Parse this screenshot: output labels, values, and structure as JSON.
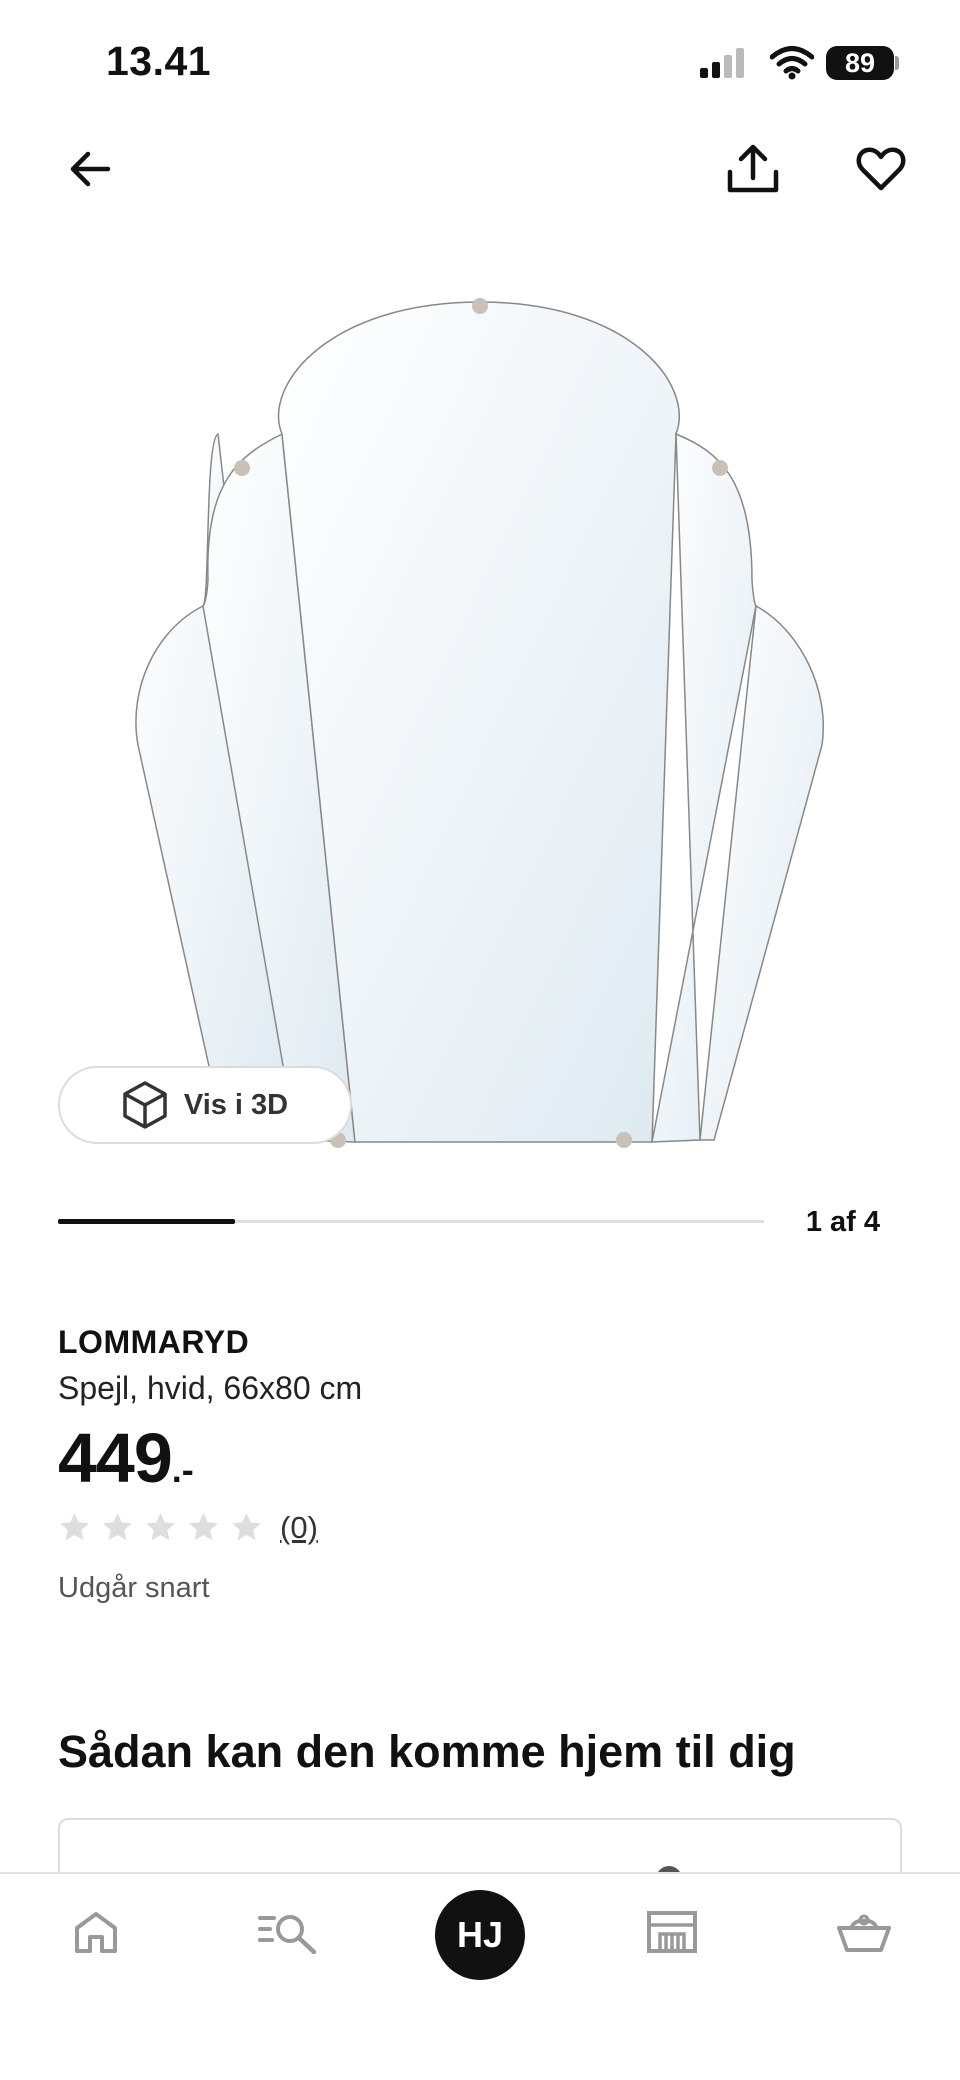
{
  "status_bar": {
    "time": "13.41",
    "battery": "89"
  },
  "header": {
    "back_icon": "arrow-left-icon",
    "share_icon": "share-icon",
    "favorite_icon": "heart-icon"
  },
  "gallery": {
    "view_3d_label": "Vis i 3D",
    "counter": "1 af 4",
    "progress_fraction": 0.25
  },
  "product": {
    "name": "LOMMARYD",
    "description": "Spejl, hvid, 66x80 cm",
    "price": "449",
    "price_suffix": ".-",
    "rating_stars": 0,
    "rating_count": "(0)",
    "availability": "Udgår snart"
  },
  "delivery": {
    "heading": "Sådan kan den komme hjem til dig"
  },
  "tabbar": {
    "profile_initials": "HJ",
    "tabs": [
      "home-icon",
      "search-icon",
      "profile-avatar",
      "store-icon",
      "basket-icon"
    ]
  },
  "colors": {
    "text": "#111111",
    "muted": "#555555",
    "divider": "#dfdfdf",
    "star": "#dedede"
  }
}
